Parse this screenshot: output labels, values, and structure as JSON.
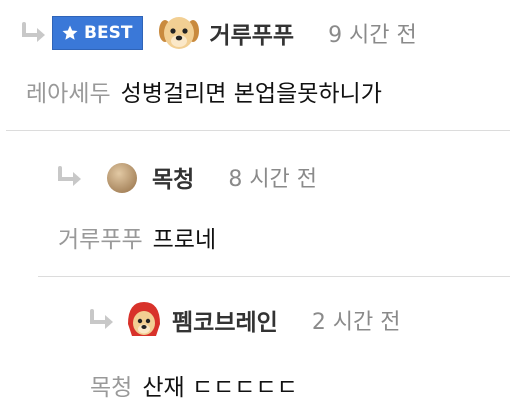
{
  "comments": [
    {
      "badge": "BEST",
      "author": "거루푸푸",
      "time": "9 시간 전",
      "mention": "레아세두",
      "text": "성병걸리면 본업을못하니가"
    },
    {
      "author": "목청",
      "time": "8 시간 전",
      "mention": "거루푸푸",
      "text": "프로네"
    },
    {
      "author": "펨코브레인",
      "time": "2 시간 전",
      "mention": "목청",
      "text": "산재 ㄷㄷㄷㄷㄷ"
    }
  ],
  "colors": {
    "best_badge": "#3a78d8",
    "reply_arrow": "#c8c8c8",
    "mention": "#999999",
    "time": "#8a8a8a"
  },
  "icons": {
    "reply": "reply-arrow-icon",
    "star": "star-icon",
    "avatar1": "puppy-avatar-icon",
    "avatar2": "round-brown-avatar-icon",
    "avatar3": "puppy-red-hood-avatar-icon"
  }
}
